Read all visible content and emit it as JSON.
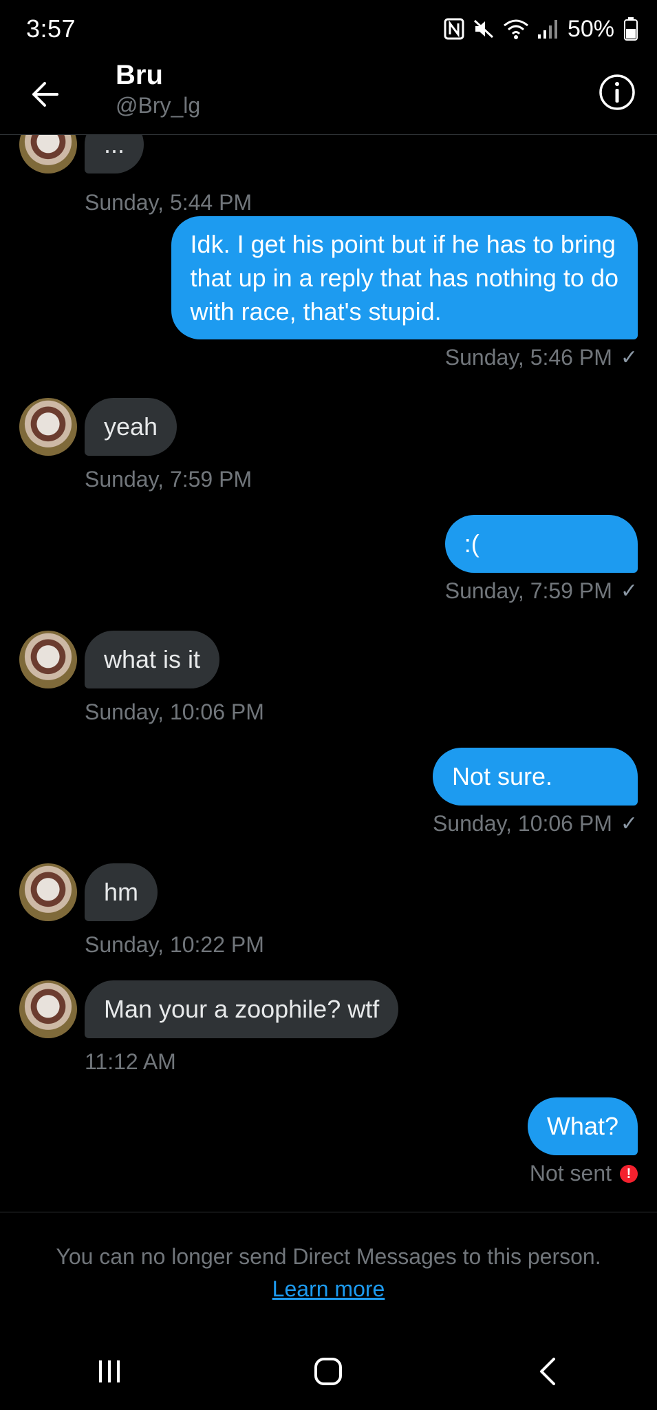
{
  "status_bar": {
    "time": "3:57",
    "battery": "50%",
    "icons": [
      "nfc-icon",
      "mute-icon",
      "wifi-icon",
      "signal-icon",
      "battery-icon"
    ]
  },
  "header": {
    "name": "Bru",
    "handle": "@Bry_lg"
  },
  "messages": [
    {
      "direction": "in",
      "text": "...",
      "time": "Sunday, 5:44 PM"
    },
    {
      "direction": "out",
      "text": "Idk. I get his point but if he has to bring\nthat up in a reply that has nothing to do\nwith race, that's stupid.",
      "time": "Sunday, 5:46 PM",
      "status": "sent"
    },
    {
      "direction": "in",
      "text": "yeah",
      "time": "Sunday, 7:59 PM"
    },
    {
      "direction": "out",
      "text": ":(",
      "time": "Sunday, 7:59 PM",
      "status": "sent"
    },
    {
      "direction": "in",
      "text": "what is it",
      "time": "Sunday, 10:06 PM"
    },
    {
      "direction": "out",
      "text": "Not sure.",
      "time": "Sunday, 10:06 PM",
      "status": "sent"
    },
    {
      "direction": "in",
      "text": "hm",
      "time": "Sunday, 10:22 PM"
    },
    {
      "direction": "in",
      "text": "Man your a zoophile? wtf",
      "time": "11:12 AM"
    },
    {
      "direction": "out",
      "text": "What?",
      "time": "Not sent",
      "status": "failed"
    }
  ],
  "notice": {
    "text": "You can no longer send Direct Messages to this person.",
    "link": "Learn more"
  },
  "colors": {
    "background": "#000000",
    "bubble_out": "#1d9bf0",
    "bubble_in": "#2f3336",
    "muted_text": "#71767b",
    "error": "#f4212e"
  }
}
